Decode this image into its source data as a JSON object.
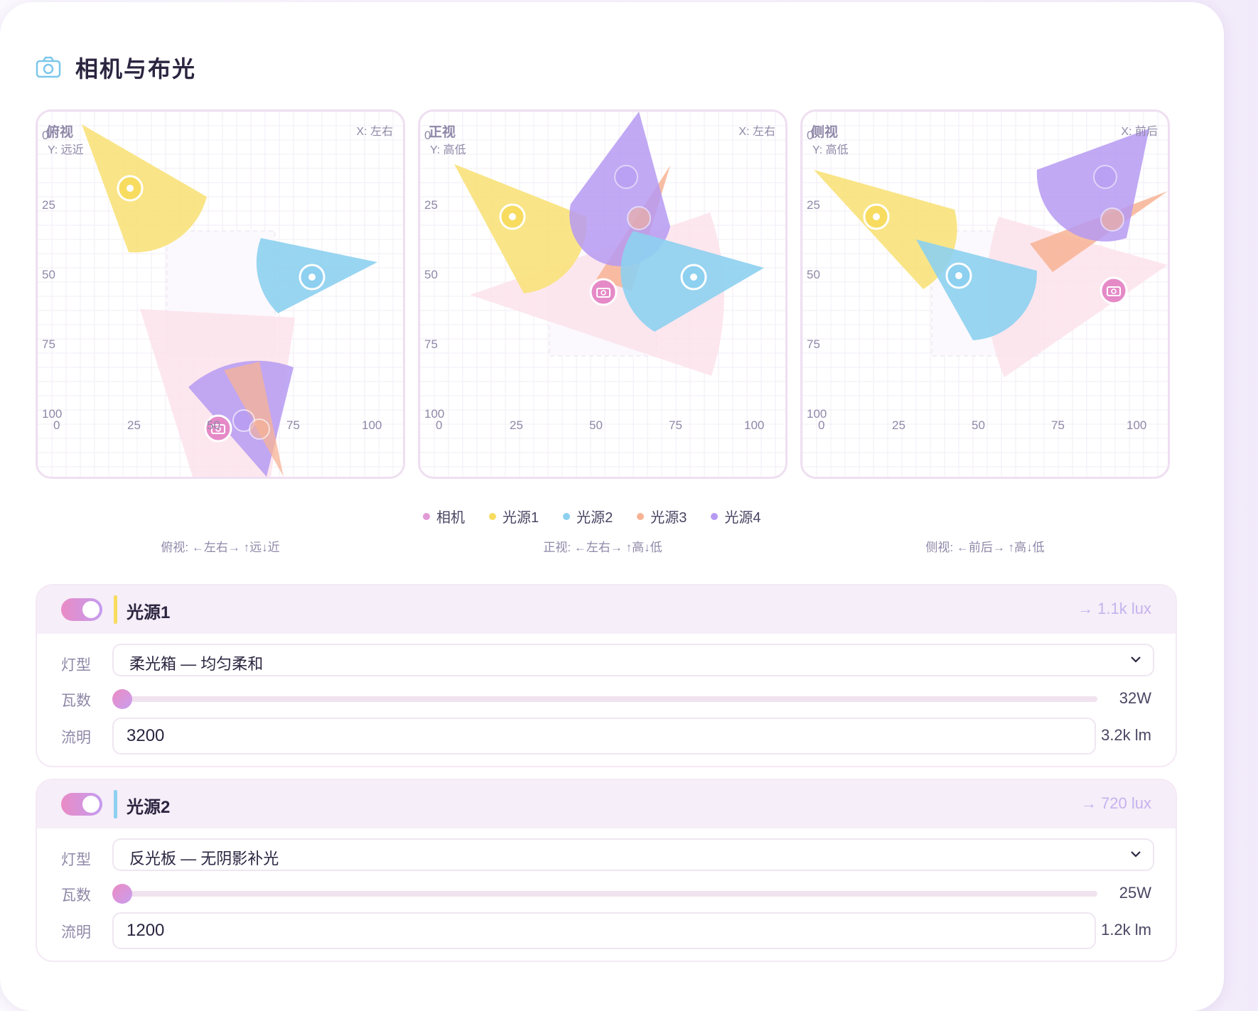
{
  "section": {
    "title": "相机与布光",
    "icon": "camera-icon"
  },
  "views": [
    {
      "name": "俯视",
      "x_axis": "X: 左右",
      "y_axis": "Y: 远近",
      "caption": "俯视: ←左右→ ↑远↓近"
    },
    {
      "name": "正视",
      "x_axis": "X: 左右",
      "y_axis": "Y: 高低",
      "caption": "正视: ←左右→ ↑高↓低"
    },
    {
      "name": "侧视",
      "x_axis": "X: 前后",
      "y_axis": "Y: 高低",
      "caption": "侧视: ←前后→ ↑高↓低"
    }
  ],
  "ticks": {
    "y": [
      "0",
      "25",
      "50",
      "75",
      "100"
    ],
    "x": [
      "0",
      "25",
      "50",
      "75",
      "100"
    ]
  },
  "legend": [
    {
      "label": "相机",
      "color": "#e29ad6"
    },
    {
      "label": "光源1",
      "color": "#f7dc60"
    },
    {
      "label": "光源2",
      "color": "#8dd0f0"
    },
    {
      "label": "光源3",
      "color": "#f7b394"
    },
    {
      "label": "光源4",
      "color": "#b69af2"
    }
  ],
  "lights": [
    {
      "name": "光源1",
      "color": "#f7dc60",
      "enabled": true,
      "lux": "→ 1.1k lux",
      "type_label": "灯型",
      "type_value": "柔光箱 — 均匀柔和",
      "watt_label": "瓦数",
      "watt_value": "32W",
      "watt_fraction": 0.0,
      "lumen_label": "流明",
      "lumen_value": "3200",
      "lumen_display": "3.2k lm"
    },
    {
      "name": "光源2",
      "color": "#8dd0f0",
      "enabled": true,
      "lux": "→ 720 lux",
      "type_label": "灯型",
      "type_value": "反光板 — 无阴影补光",
      "watt_label": "瓦数",
      "watt_value": "25W",
      "watt_fraction": 0.0,
      "lumen_label": "流明",
      "lumen_value": "1200",
      "lumen_display": "1.2k lm"
    }
  ]
}
